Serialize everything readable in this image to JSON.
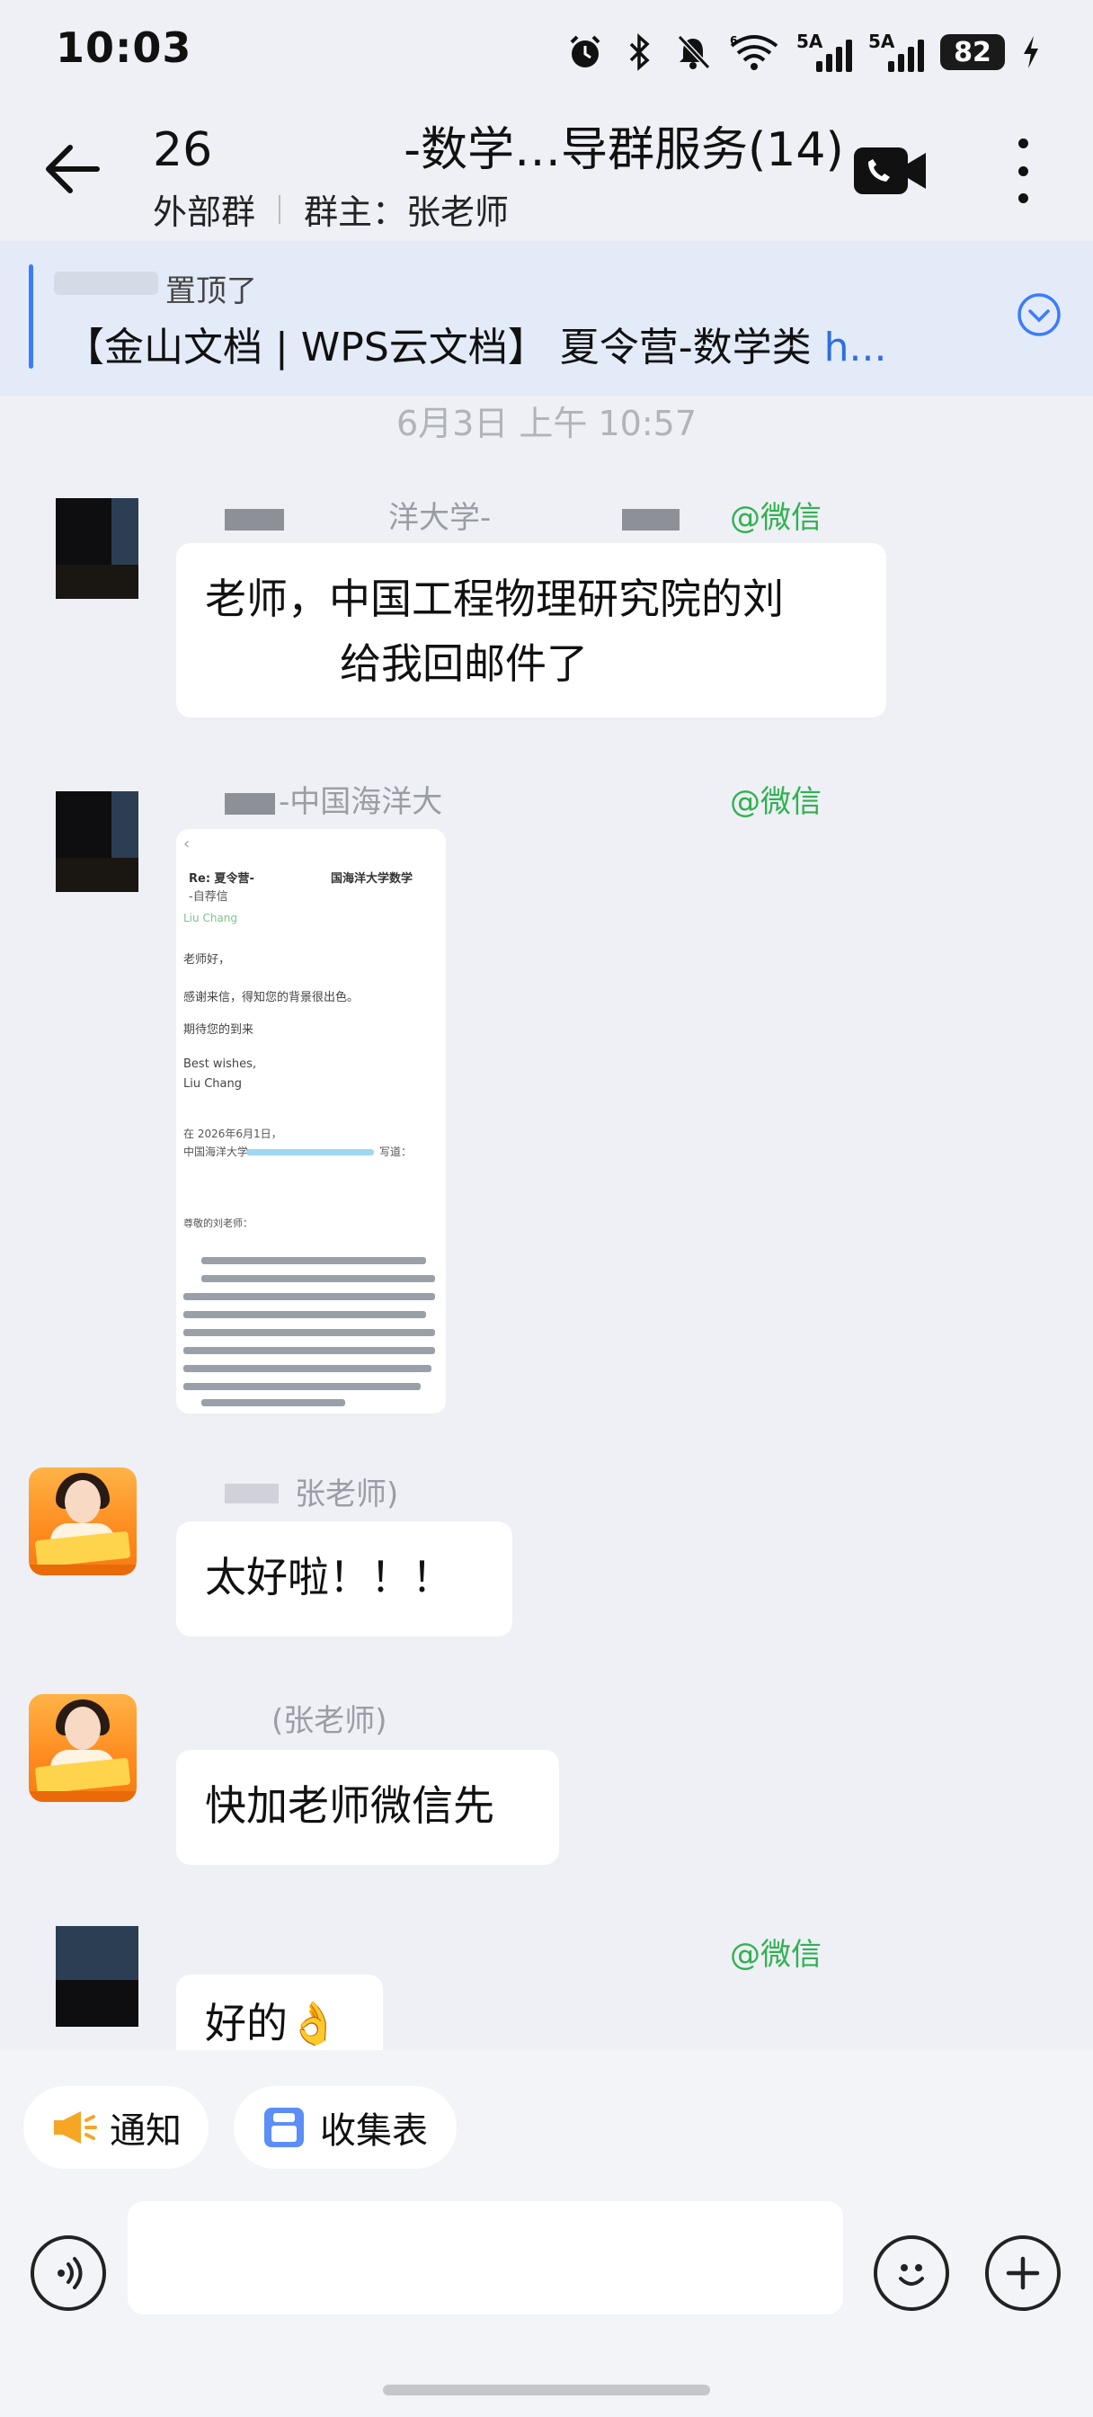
{
  "status_bar": {
    "time": "10:03",
    "network_label_1": "5A",
    "network_label_2": "5A",
    "battery": "82",
    "icons": [
      "alarm-icon",
      "bluetooth-icon",
      "mute-icon",
      "wifi-6-icon",
      "signal-icon",
      "signal-icon",
      "battery-icon",
      "charging-icon"
    ]
  },
  "header": {
    "title_prefix": "26",
    "title_suffix": "-数学…导群服务(14)",
    "group_type": "外部群",
    "owner": "群主：张老师",
    "icons": [
      "back-arrow-icon",
      "video-call-icon",
      "more-vertical-icon"
    ]
  },
  "pinned": {
    "label": "置顶了",
    "content": "【金山文档 | WPS云文档】 夏令营-数学类 ",
    "link_text": "h...",
    "icon": "chevron-down-circle-icon"
  },
  "timestamp": "6月3日  上午 10:57",
  "messages": [
    {
      "sender": "洋大学-",
      "tag": "@微信",
      "text_line1": "老师，中国工程物理研究院的刘",
      "text_line2": "给我回邮件了"
    },
    {
      "sender": "-中国海洋大",
      "tag": "@微信",
      "attachment": {
        "title_left": "Re: 夏令营-",
        "title_right": "国海洋大学数学",
        "title_sub": "-自荐信",
        "from": "Liu Chang",
        "greeting": "老师好，",
        "body": "感谢来信，得知您的背景很出色。",
        "regards": "期待您的到来",
        "sign_1": "Best wishes,",
        "sign_2": "Liu Chang",
        "quote_head": "在 2026年6月1日，",
        "quote_org": "中国海洋大学",
        "quote_tail": "写道：",
        "quote_greeting": "尊敬的刘老师："
      }
    },
    {
      "sender": "张老师)",
      "text": "太好啦！！！"
    },
    {
      "sender": "(张老师)",
      "text": "快加老师微信先"
    },
    {
      "sender": "",
      "tag": "@微信",
      "text": "好的",
      "emoji": "👌"
    }
  ],
  "toolbar": {
    "notify_label": "通知",
    "form_label": "收集表",
    "icons": [
      "megaphone-icon",
      "clipboard-icon"
    ]
  },
  "input": {
    "placeholder": "",
    "icons": [
      "voice-icon",
      "emoji-icon",
      "plus-icon"
    ]
  }
}
